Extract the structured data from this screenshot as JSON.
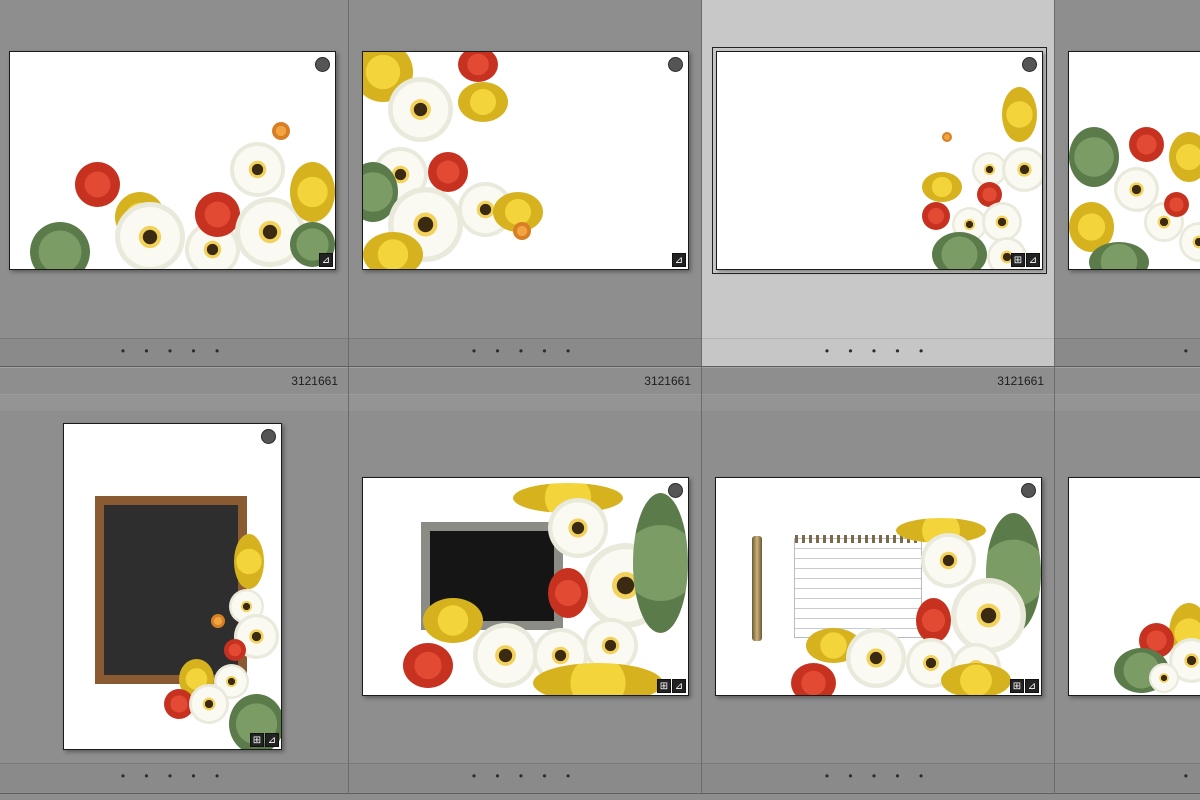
{
  "grid": {
    "row1": {
      "cells": [
        {
          "rating_dots": "• • • • •"
        },
        {
          "rating_dots": "• • • • •"
        },
        {
          "rating_dots": "• • • • •"
        },
        {
          "rating_dots": "•"
        }
      ]
    },
    "row2": {
      "cells": [
        {
          "file_id": "3121661",
          "rating_dots": "• • • • •"
        },
        {
          "file_id": "3121661",
          "rating_dots": "• • • • •"
        },
        {
          "file_id": "3121661",
          "rating_dots": "• • • • •"
        },
        {
          "file_id": "",
          "rating_dots": "•"
        }
      ]
    }
  },
  "badges": {
    "develop_icon": "⊿",
    "crop_icon": "⊞"
  },
  "colors": {
    "grid_background": "#8e8e8e",
    "selected_cell": "#c8c8c8",
    "flag_dot": "#555555"
  }
}
